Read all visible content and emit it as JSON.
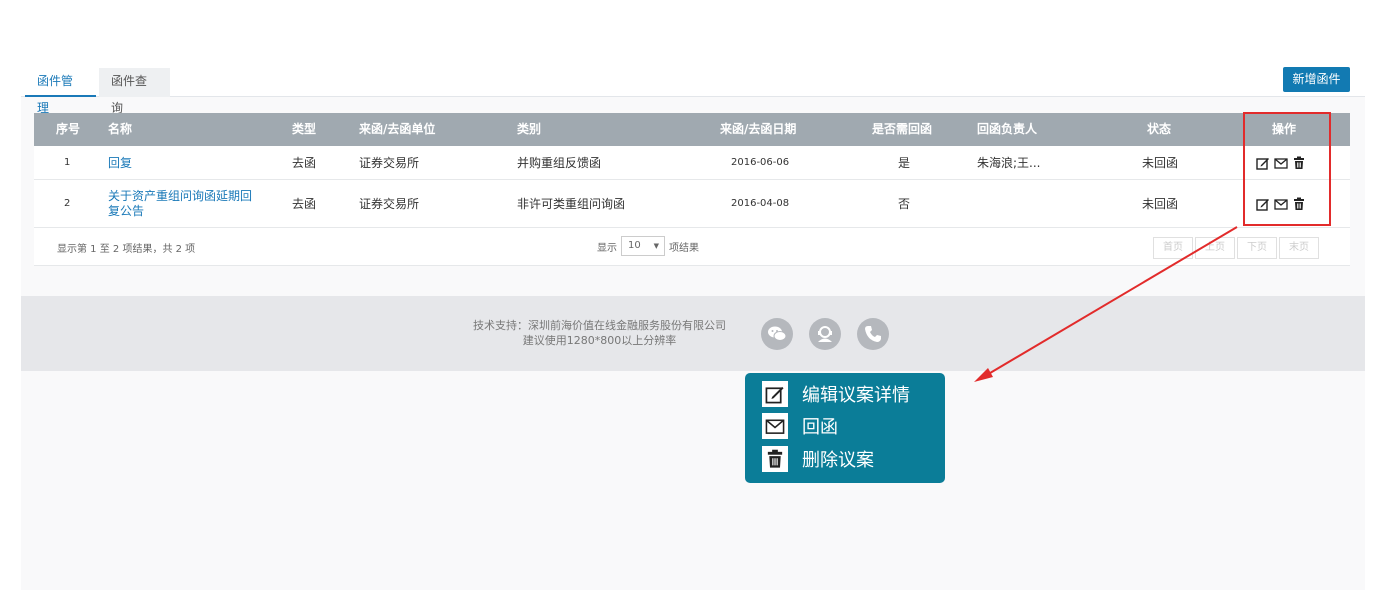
{
  "tabs": [
    {
      "label": "函件管理",
      "active": true
    },
    {
      "label": "函件查询",
      "active": false
    }
  ],
  "add_button": "新增函件",
  "table": {
    "headers": [
      "序号",
      "名称",
      "类型",
      "来函/去函单位",
      "类别",
      "来函/去函日期",
      "是否需回函",
      "回函负责人",
      "状态",
      "操作"
    ],
    "rows": [
      {
        "no": "1",
        "name": "回复",
        "type": "去函",
        "unit": "证券交易所",
        "category": "并购重组反馈函",
        "date": "2016-06-06",
        "need_reply": "是",
        "owner": "朱海浪;王...",
        "status": "未回函"
      },
      {
        "no": "2",
        "name": "关于资产重组问询函延期回复公告",
        "type": "去函",
        "unit": "证券交易所",
        "category": "非许可类重组问询函",
        "date": "2016-04-08",
        "need_reply": "否",
        "owner": "",
        "status": "未回函"
      }
    ]
  },
  "footer_bar": {
    "info": "显示第 1 至 2 项结果，共 2 项",
    "show_label": "显示",
    "page_size": "10",
    "unit_label": "项结果",
    "pager": [
      "首页",
      "上页",
      "下页",
      "末页"
    ]
  },
  "support": {
    "line1": "技术支持：深圳前海价值在线金融服务股份有限公司",
    "line2": "建议使用1280*800以上分辨率"
  },
  "icons": {
    "edit": "edit-icon",
    "mail": "mail-icon",
    "delete": "trash-icon"
  },
  "callout": {
    "items": [
      {
        "label": "编辑议案详情",
        "icon": "edit-icon"
      },
      {
        "label": "回函",
        "icon": "mail-icon"
      },
      {
        "label": "删除议案",
        "icon": "trash-icon"
      }
    ]
  },
  "colors": {
    "accent": "#127ab2",
    "header_bg": "#a0a9b0",
    "callout_bg": "#0b7d98",
    "highlight": "#e22b2b"
  }
}
